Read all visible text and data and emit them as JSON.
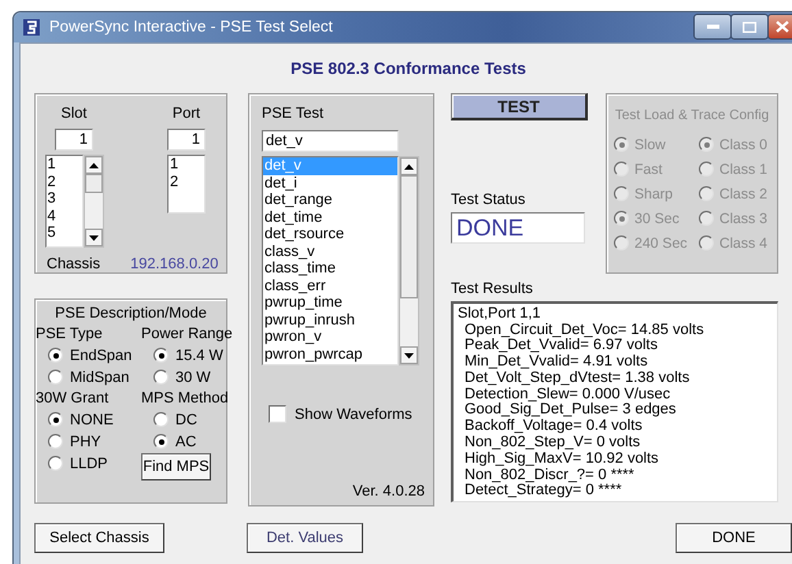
{
  "window": {
    "title": "PowerSync Interactive - PSE Test Select"
  },
  "heading": "PSE 802.3 Conformance Tests",
  "slot": {
    "label": "Slot",
    "value": "1",
    "items": [
      "1",
      "2",
      "3",
      "4",
      "5"
    ]
  },
  "port": {
    "label": "Port",
    "value": "1",
    "items": [
      "1",
      "2"
    ]
  },
  "chassis": {
    "label": "Chassis",
    "address": "192.168.0.20"
  },
  "pse_mode": {
    "title": "PSE Description/Mode",
    "pse_type": {
      "label": "PSE Type",
      "options": [
        {
          "label": "EndSpan",
          "selected": true
        },
        {
          "label": "MidSpan",
          "selected": false
        }
      ]
    },
    "power_range": {
      "label": "Power Range",
      "options": [
        {
          "label": "15.4 W",
          "selected": true
        },
        {
          "label": "30 W",
          "selected": false
        }
      ]
    },
    "grant_30w": {
      "label": "30W Grant",
      "options": [
        {
          "label": "NONE",
          "selected": true
        },
        {
          "label": "PHY",
          "selected": false
        },
        {
          "label": "LLDP",
          "selected": false
        }
      ]
    },
    "mps_method": {
      "label": "MPS Method",
      "options": [
        {
          "label": "DC",
          "selected": false
        },
        {
          "label": "AC",
          "selected": true
        }
      ]
    },
    "find_mps_button": "Find MPS"
  },
  "pse_test": {
    "label": "PSE Test",
    "value": "det_v",
    "items": [
      {
        "label": "det_v",
        "selected": true
      },
      {
        "label": "det_i",
        "selected": false
      },
      {
        "label": "det_range",
        "selected": false
      },
      {
        "label": "det_time",
        "selected": false
      },
      {
        "label": "det_rsource",
        "selected": false
      },
      {
        "label": "class_v",
        "selected": false
      },
      {
        "label": "class_time",
        "selected": false
      },
      {
        "label": "class_err",
        "selected": false
      },
      {
        "label": "pwrup_time",
        "selected": false
      },
      {
        "label": "pwrup_inrush",
        "selected": false
      },
      {
        "label": "pwron_v",
        "selected": false
      },
      {
        "label": "pwron_pwrcap",
        "selected": false
      }
    ],
    "show_waveforms": {
      "label": "Show Waveforms",
      "checked": false
    },
    "version": "Ver. 4.0.28"
  },
  "test_button": "TEST",
  "test_load_config": {
    "title": "Test Load & Trace Config",
    "disabled": true,
    "rates": [
      {
        "label": "Slow",
        "selected": true
      },
      {
        "label": "Fast",
        "selected": false
      },
      {
        "label": "Sharp",
        "selected": false
      },
      {
        "label": "30 Sec",
        "selected": true
      },
      {
        "label": "240 Sec",
        "selected": false
      }
    ],
    "classes": [
      {
        "label": "Class 0",
        "selected": true
      },
      {
        "label": "Class 1",
        "selected": false
      },
      {
        "label": "Class 2",
        "selected": false
      },
      {
        "label": "Class 3",
        "selected": false
      },
      {
        "label": "Class 4",
        "selected": false
      }
    ]
  },
  "test_status": {
    "label": "Test Status",
    "value": "DONE"
  },
  "test_results": {
    "label": "Test Results",
    "header": "Slot,Port 1,1",
    "lines": [
      "Open_Circuit_Det_Voc= 14.85 volts",
      "Peak_Det_Vvalid= 6.97 volts",
      "Min_Det_Vvalid= 4.91 volts",
      "Det_Volt_Step_dVtest= 1.38 volts",
      "Detection_Slew= 0.000 V/usec",
      "Good_Sig_Det_Pulse= 3 edges",
      "Backoff_Voltage= 0.4 volts",
      "Non_802_Step_V= 0 volts",
      "High_Sig_MaxV= 10.92 volts",
      "Non_802_Discr_?= 0 ****",
      "Detect_Strategy= 0 ****"
    ]
  },
  "buttons": [
    {
      "label": "Select Chassis",
      "kind": "normal"
    },
    {
      "label": "Det. Values",
      "kind": "muted"
    },
    {
      "label": "DONE",
      "kind": "normal"
    }
  ]
}
